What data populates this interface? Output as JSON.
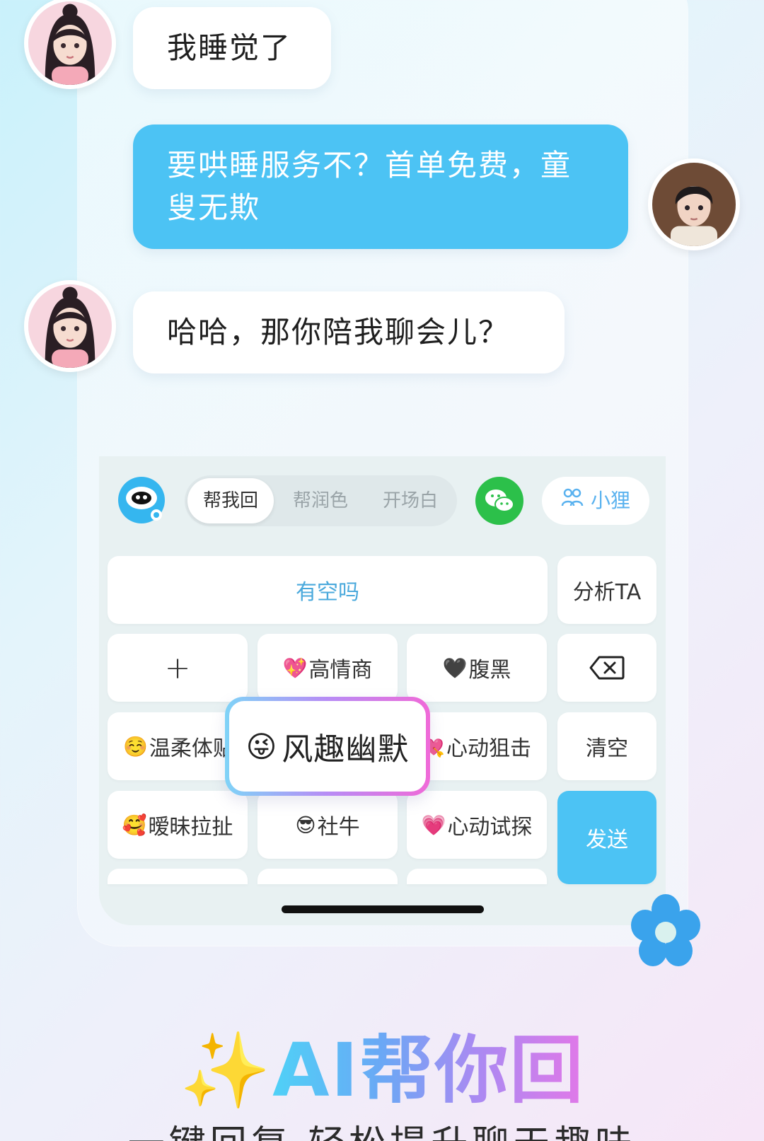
{
  "chat": {
    "messages": [
      {
        "side": "left",
        "text": "我睡觉了"
      },
      {
        "side": "right",
        "text": "要哄睡服务不？首单免费，童叟无欺"
      },
      {
        "side": "left",
        "text": "哈哈，那你陪我聊会儿？"
      }
    ]
  },
  "keyboard": {
    "tabs": [
      "帮我回",
      "帮润色",
      "开场白"
    ],
    "active_tab": "帮我回",
    "user_label": "小狸",
    "suggestion": "有空吗",
    "analyze_label": "分析TA",
    "plus_label": "+",
    "styles": [
      {
        "emoji": "💖",
        "label": "高情商"
      },
      {
        "emoji": "🖤",
        "label": "腹黑"
      },
      {
        "emoji": "☺️",
        "label": "温柔体贴"
      },
      {
        "emoji": "💘",
        "label": "心动狙击"
      },
      {
        "emoji": "🥰",
        "label": "暧昧拉扯"
      },
      {
        "emoji": "😎",
        "label": "社牛"
      },
      {
        "emoji": "💗",
        "label": "心动试探"
      }
    ],
    "popup": {
      "emoji": "😜",
      "label": "风趣幽默"
    },
    "clear_label": "清空",
    "send_label": "发送"
  },
  "promo": {
    "sparkle": "✨",
    "headline": "AI帮你回",
    "subline": "一键回复 轻松提升聊天趣味"
  },
  "colors": {
    "accent_blue": "#4cc3f4",
    "wechat_green": "#2cc04a",
    "gradient": [
      "#4fd1f7",
      "#a98af2",
      "#e178e8"
    ]
  }
}
